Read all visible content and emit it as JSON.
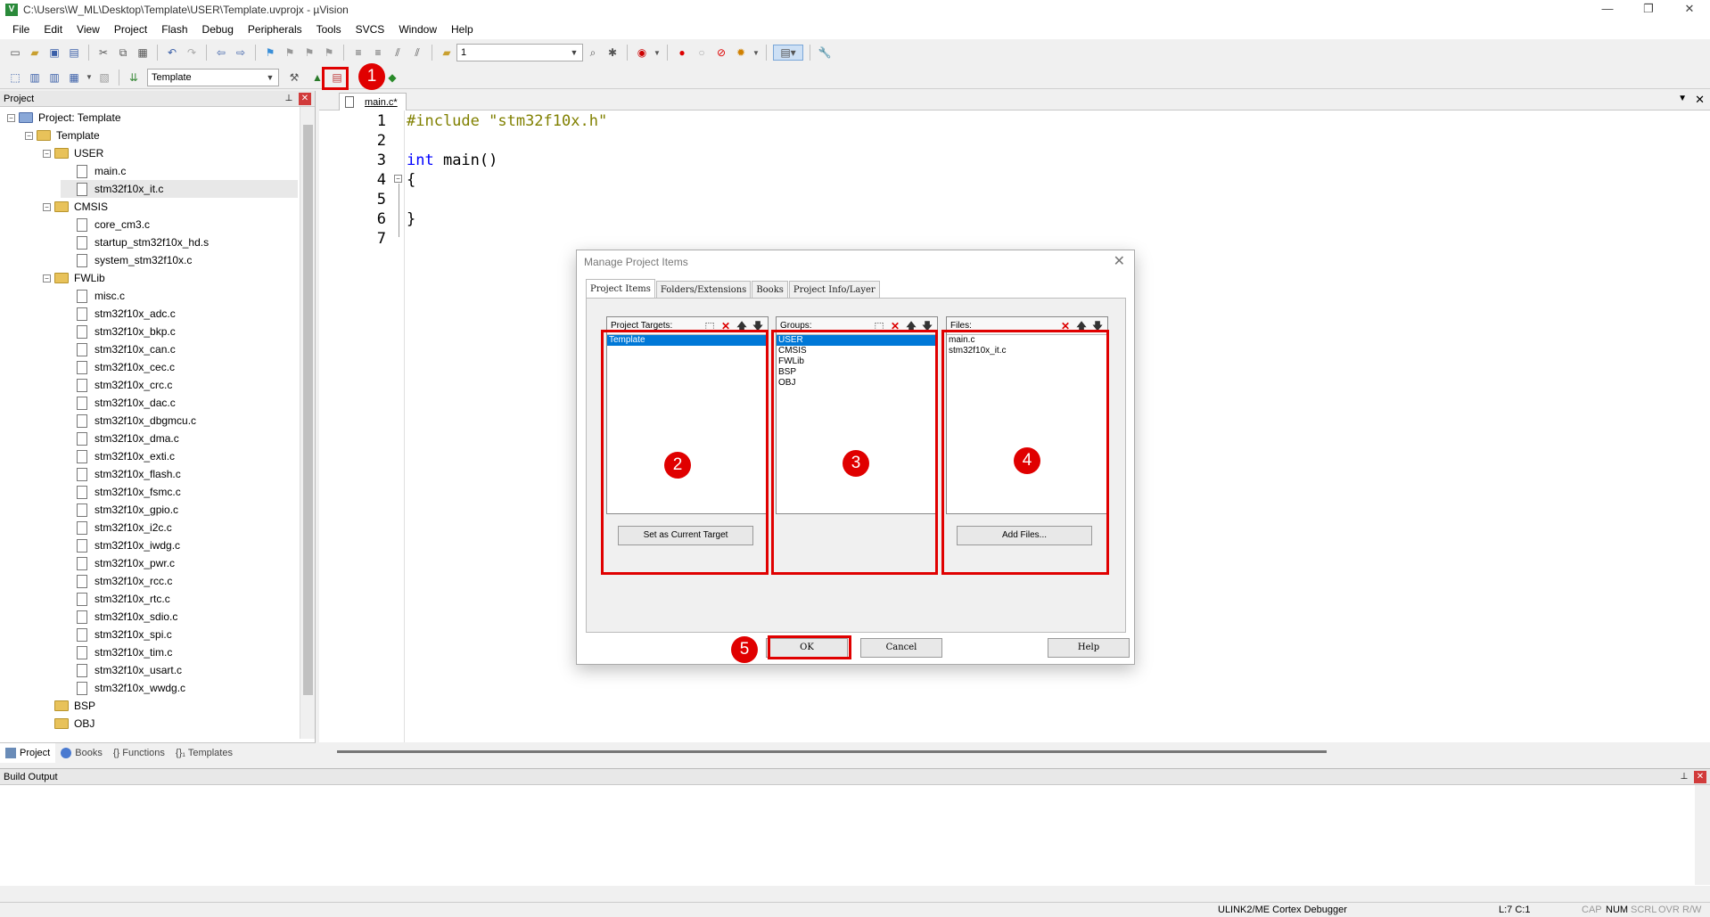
{
  "window": {
    "title": "C:\\Users\\W_ML\\Desktop\\Template\\USER\\Template.uvprojx - µVision",
    "app_icon_letter": "V",
    "minimize": "—",
    "restore": "❐",
    "close": "✕"
  },
  "menu": [
    "File",
    "Edit",
    "View",
    "Project",
    "Flash",
    "Debug",
    "Peripherals",
    "Tools",
    "SVCS",
    "Window",
    "Help"
  ],
  "toolbar": {
    "find_value": "1",
    "target_value": "Template"
  },
  "annotations": [
    "1",
    "2",
    "3",
    "4",
    "5"
  ],
  "project_panel": {
    "title": "Project",
    "tree": [
      {
        "label": "Project: Template",
        "depth": 0,
        "kind": "root"
      },
      {
        "label": "Template",
        "depth": 1,
        "kind": "folder"
      },
      {
        "label": "USER",
        "depth": 2,
        "kind": "folder"
      },
      {
        "label": "main.c",
        "depth": 3,
        "kind": "file"
      },
      {
        "label": "stm32f10x_it.c",
        "depth": 3,
        "kind": "file"
      },
      {
        "label": "CMSIS",
        "depth": 2,
        "kind": "folder"
      },
      {
        "label": "core_cm3.c",
        "depth": 3,
        "kind": "file"
      },
      {
        "label": "startup_stm32f10x_hd.s",
        "depth": 3,
        "kind": "file"
      },
      {
        "label": "system_stm32f10x.c",
        "depth": 3,
        "kind": "file"
      },
      {
        "label": "FWLib",
        "depth": 2,
        "kind": "folder"
      },
      {
        "label": "misc.c",
        "depth": 3,
        "kind": "file"
      },
      {
        "label": "stm32f10x_adc.c",
        "depth": 3,
        "kind": "file"
      },
      {
        "label": "stm32f10x_bkp.c",
        "depth": 3,
        "kind": "file"
      },
      {
        "label": "stm32f10x_can.c",
        "depth": 3,
        "kind": "file"
      },
      {
        "label": "stm32f10x_cec.c",
        "depth": 3,
        "kind": "file"
      },
      {
        "label": "stm32f10x_crc.c",
        "depth": 3,
        "kind": "file"
      },
      {
        "label": "stm32f10x_dac.c",
        "depth": 3,
        "kind": "file"
      },
      {
        "label": "stm32f10x_dbgmcu.c",
        "depth": 3,
        "kind": "file"
      },
      {
        "label": "stm32f10x_dma.c",
        "depth": 3,
        "kind": "file"
      },
      {
        "label": "stm32f10x_exti.c",
        "depth": 3,
        "kind": "file"
      },
      {
        "label": "stm32f10x_flash.c",
        "depth": 3,
        "kind": "file"
      },
      {
        "label": "stm32f10x_fsmc.c",
        "depth": 3,
        "kind": "file"
      },
      {
        "label": "stm32f10x_gpio.c",
        "depth": 3,
        "kind": "file"
      },
      {
        "label": "stm32f10x_i2c.c",
        "depth": 3,
        "kind": "file"
      },
      {
        "label": "stm32f10x_iwdg.c",
        "depth": 3,
        "kind": "file"
      },
      {
        "label": "stm32f10x_pwr.c",
        "depth": 3,
        "kind": "file"
      },
      {
        "label": "stm32f10x_rcc.c",
        "depth": 3,
        "kind": "file"
      },
      {
        "label": "stm32f10x_rtc.c",
        "depth": 3,
        "kind": "file"
      },
      {
        "label": "stm32f10x_sdio.c",
        "depth": 3,
        "kind": "file"
      },
      {
        "label": "stm32f10x_spi.c",
        "depth": 3,
        "kind": "file"
      },
      {
        "label": "stm32f10x_tim.c",
        "depth": 3,
        "kind": "file"
      },
      {
        "label": "stm32f10x_usart.c",
        "depth": 3,
        "kind": "file"
      },
      {
        "label": "stm32f10x_wwdg.c",
        "depth": 3,
        "kind": "file"
      },
      {
        "label": "BSP",
        "depth": 2,
        "kind": "folder-leaf"
      },
      {
        "label": "OBJ",
        "depth": 2,
        "kind": "folder-leaf"
      }
    ],
    "tabs": [
      "Project",
      "Books",
      "{} Functions",
      "{}₁ Templates"
    ]
  },
  "editor": {
    "tab": "main.c*",
    "lines": [
      {
        "n": "1",
        "segments": [
          {
            "t": "#include ",
            "c": "#808000"
          },
          {
            "t": "\"stm32f10x.h\"",
            "c": "#808000"
          }
        ]
      },
      {
        "n": "2",
        "segments": []
      },
      {
        "n": "3",
        "segments": [
          {
            "t": "int",
            "c": "#0000ff"
          },
          {
            "t": " main()",
            "c": "#000000"
          }
        ]
      },
      {
        "n": "4",
        "segments": [
          {
            "t": "{",
            "c": "#000000"
          }
        ]
      },
      {
        "n": "5",
        "segments": []
      },
      {
        "n": "6",
        "segments": [
          {
            "t": "}",
            "c": "#000000"
          }
        ]
      },
      {
        "n": "7",
        "segments": []
      }
    ]
  },
  "build_output": {
    "title": "Build Output"
  },
  "status": {
    "debugger": "ULINK2/ME Cortex Debugger",
    "position": "L:7 C:1",
    "caps": "CAP",
    "num": "NUM",
    "scrl": "SCRL",
    "ovr": "OVR",
    "rw": "R/W"
  },
  "dialog": {
    "title": "Manage Project Items",
    "close": "✕",
    "tabs": [
      "Project Items",
      "Folders/Extensions",
      "Books",
      "Project Info/Layer"
    ],
    "targets": {
      "header": "Project Targets:",
      "items": [
        "Template"
      ],
      "selected": 0
    },
    "groups": {
      "header": "Groups:",
      "items": [
        "USER",
        "CMSIS",
        "FWLib",
        "BSP",
        "OBJ"
      ],
      "selected": 0
    },
    "files": {
      "header": "Files:",
      "items": [
        "main.c",
        "stm32f10x_it.c"
      ]
    },
    "set_current_target": "Set as Current Target",
    "add_files": "Add Files...",
    "ok": "OK",
    "cancel": "Cancel",
    "help": "Help"
  },
  "colors": {
    "accent_red": "#e00000",
    "selection_blue": "#0078d7"
  }
}
